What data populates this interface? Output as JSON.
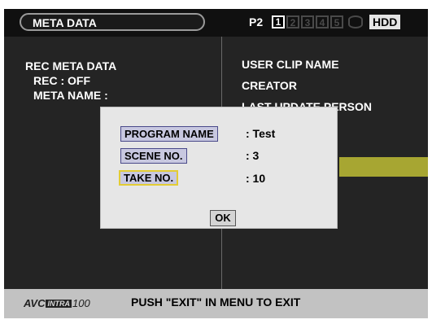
{
  "header": {
    "title": "META DATA",
    "media_label": "P2",
    "slots": [
      "1",
      "2",
      "3",
      "4",
      "5"
    ],
    "hdd_label": "HDD"
  },
  "left_panel": {
    "heading": "REC META DATA",
    "rec_line": "REC : OFF",
    "meta_name_line": "META NAME :"
  },
  "right_panel": {
    "items": [
      "USER CLIP NAME",
      "CREATOR",
      "LAST UPDATE PERSON"
    ]
  },
  "dialog": {
    "fields": [
      {
        "label": "PROGRAM NAME",
        "value": ":  Test"
      },
      {
        "label": "SCENE NO.",
        "value": ":  3"
      },
      {
        "label": "TAKE NO.",
        "value": ":  10"
      }
    ],
    "ok_label": "OK"
  },
  "footer": {
    "logo_prefix": "AVC",
    "logo_badge": "INTRA",
    "logo_suffix": "100",
    "message": "PUSH \"EXIT\" IN MENU TO EXIT"
  },
  "colors": {
    "screen_bg": "#242424",
    "highlight_band": "#a7a632",
    "dialog_bg": "#e6e6e6",
    "selected_border": "#e3cc35"
  }
}
